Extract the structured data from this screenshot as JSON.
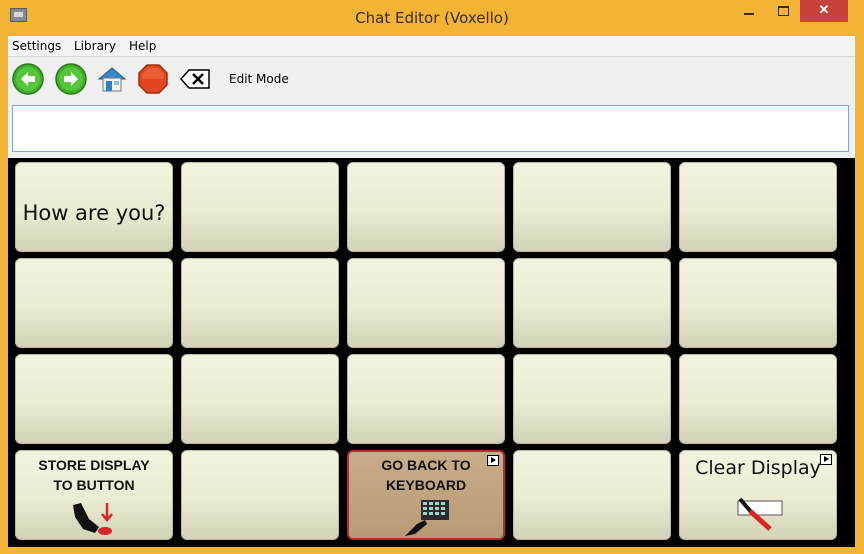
{
  "window": {
    "title": "Chat Editor (Voxello)",
    "icon": "voxello-app-icon",
    "controls": {
      "minimize": "minimize-icon",
      "maximize": "maximize-icon",
      "close": "close-icon"
    }
  },
  "menubar": {
    "items": [
      {
        "label": "Settings"
      },
      {
        "label": "Library"
      },
      {
        "label": "Help"
      }
    ]
  },
  "toolbar": {
    "back_icon": "back-arrow-icon",
    "forward_icon": "forward-arrow-icon",
    "home_icon": "home-icon",
    "stop_icon": "stop-icon",
    "clear_icon": "backspace-x-icon",
    "edit_mode_label": "Edit Mode"
  },
  "display": {
    "value": ""
  },
  "grid": {
    "rows": 4,
    "columns": 5,
    "buttons": {
      "r1c1": "How are you?",
      "store_line1": "STORE DISPLAY",
      "store_line2": "TO BUTTON",
      "go_back_line1": "GO BACK TO",
      "go_back_line2": "KEYBOARD",
      "clear_display": "Clear Display"
    }
  },
  "colors": {
    "titlebar": "#f3b334",
    "cell": "#ebebd3",
    "cell_go_back": "#c2a583",
    "close_button": "#c7423a",
    "go_back_border": "#b03030"
  }
}
